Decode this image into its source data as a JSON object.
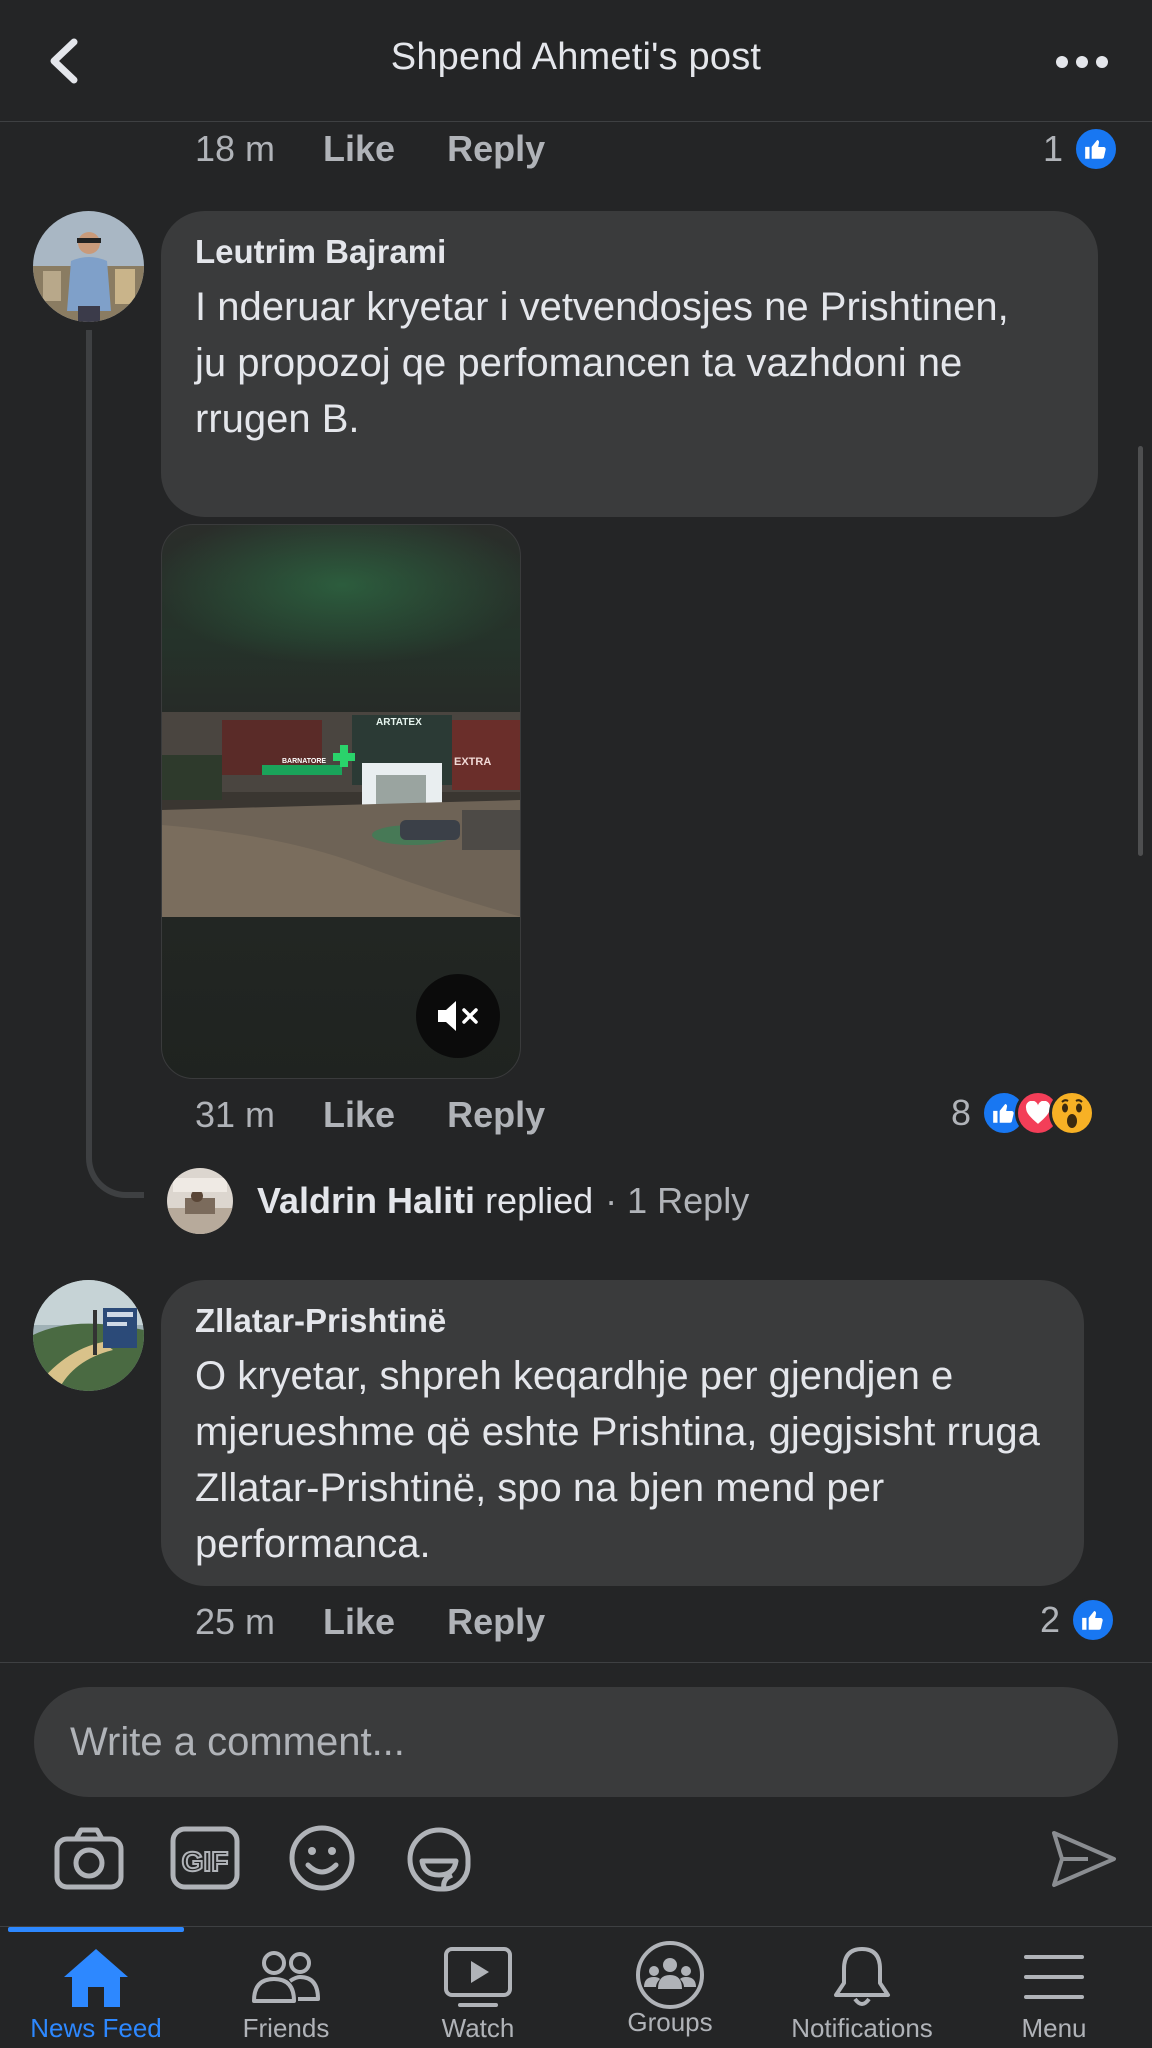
{
  "header": {
    "title": "Shpend Ahmeti's post",
    "back_icon": "chevron-left-icon",
    "more_icon": "more-horizontal-icon"
  },
  "top_comment_meta": {
    "time": "18 m",
    "like_label": "Like",
    "reply_label": "Reply",
    "reaction_count": "1"
  },
  "comments": [
    {
      "author": "Leutrim Bajrami",
      "text": "I nderuar kryetar i vetvendosjes ne Prishtinen,\nju propozoj qe perfomancen ta vazhdoni ne rrugen B.",
      "time": "31 m",
      "like_label": "Like",
      "reply_label": "Reply",
      "reaction_count": "8",
      "reactions": [
        "like",
        "love",
        "wow"
      ],
      "video": {
        "sign_1": "ARTATEX",
        "sign_2": "BARNATORE",
        "sign_3": "EXTRA",
        "mute_icon": "speaker-muted-icon"
      },
      "reply_preview": {
        "name": "Valdrin Haliti",
        "action": "replied",
        "count": "· 1 Reply"
      }
    },
    {
      "author": "Zllatar-Prishtinë",
      "text": "O kryetar, shpreh keqardhje per gjendjen e mjerueshme që eshte Prishtina, gjegjsisht rruga Zllatar-Prishtinë, spo na bjen mend per performanca.",
      "time": "25 m",
      "like_label": "Like",
      "reply_label": "Reply",
      "reaction_count": "2",
      "reactions": [
        "like"
      ]
    }
  ],
  "composer": {
    "placeholder": "Write a comment...",
    "icons": [
      "camera-icon",
      "gif-icon",
      "emoji-icon",
      "sticker-icon",
      "send-icon"
    ]
  },
  "tabs": [
    {
      "label": "News Feed",
      "icon": "home-icon",
      "active": true
    },
    {
      "label": "Friends",
      "icon": "friends-icon",
      "active": false
    },
    {
      "label": "Watch",
      "icon": "watch-icon",
      "active": false
    },
    {
      "label": "Groups",
      "icon": "groups-icon",
      "active": false
    },
    {
      "label": "Notifications",
      "icon": "bell-icon",
      "active": false
    },
    {
      "label": "Menu",
      "icon": "menu-icon",
      "active": false
    }
  ],
  "colors": {
    "background": "#242526",
    "bubble": "#3a3b3c",
    "text_primary": "#e4e6eb",
    "text_secondary": "#b0b3b8",
    "accent": "#2d88ff",
    "like_blue": "#1877f2",
    "love_red": "#f33e58",
    "wow_yellow": "#f7b125"
  }
}
